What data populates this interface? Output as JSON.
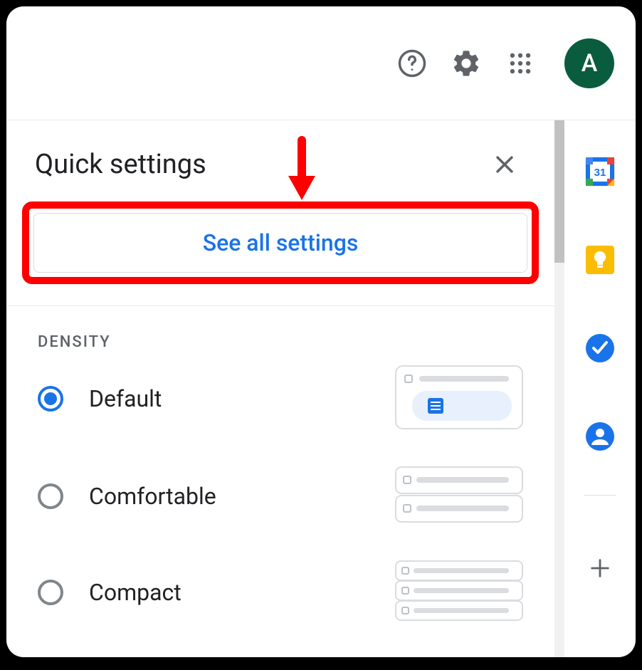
{
  "header": {
    "avatar_initial": "A"
  },
  "panel": {
    "title": "Quick settings",
    "see_all_label": "See all settings"
  },
  "density": {
    "section_label": "DENSITY",
    "options": [
      {
        "label": "Default",
        "selected": true
      },
      {
        "label": "Comfortable",
        "selected": false
      },
      {
        "label": "Compact",
        "selected": false
      }
    ]
  },
  "sidebar": {
    "calendar_day": "31"
  },
  "annotation": {
    "highlight_target": "see-all-settings-button"
  }
}
